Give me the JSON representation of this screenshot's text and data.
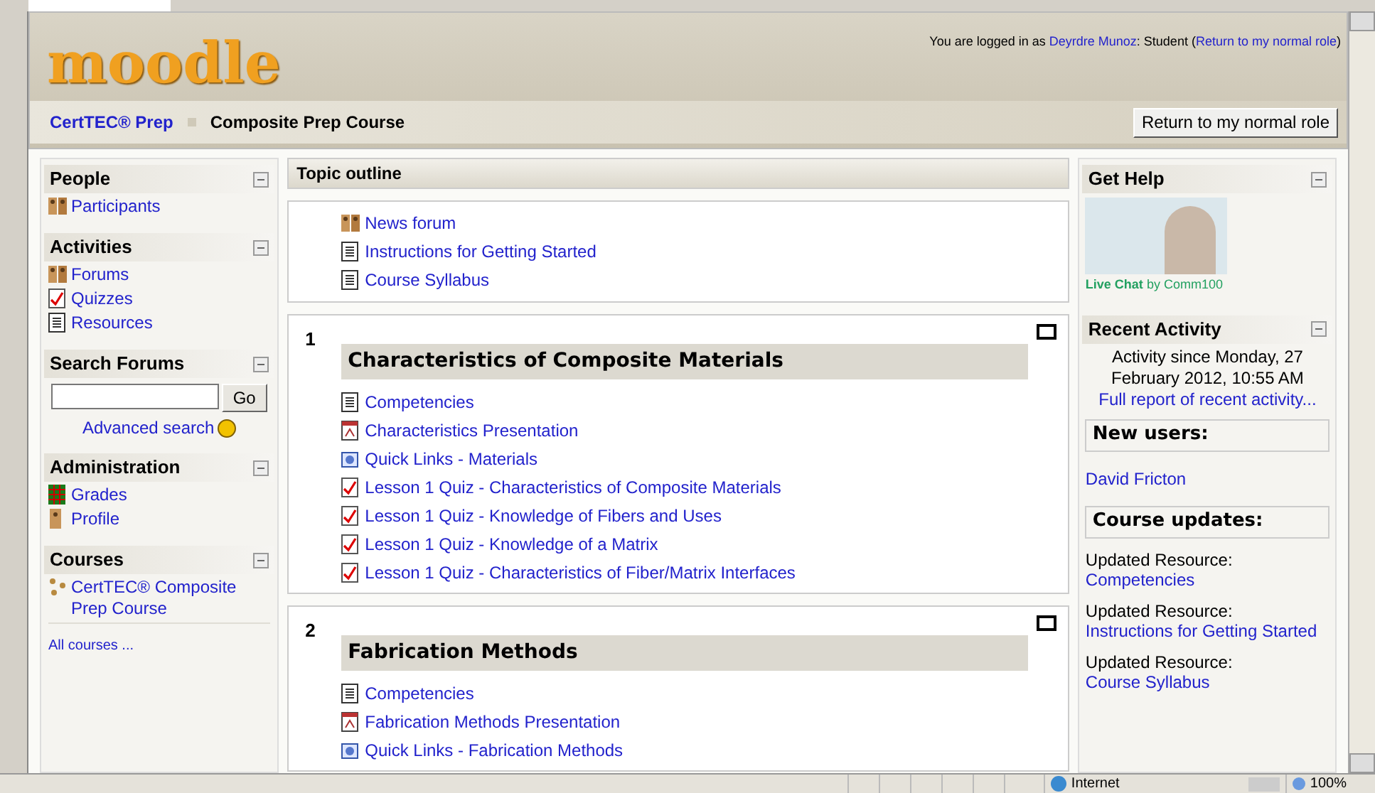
{
  "header": {
    "logo": "moodle",
    "login_prefix": "You are logged in as",
    "user": "Deyrdre Munoz",
    "login_role": ": Student (",
    "return_link": "Return to my normal role",
    "login_suffix": ")"
  },
  "navbar": {
    "breadcrumbs": [
      {
        "label": "CertTEC® Prep",
        "link": true
      },
      {
        "label": "Composite Prep Course",
        "link": false
      }
    ],
    "button": "Return to my normal role"
  },
  "left_blocks": [
    {
      "title": "People",
      "items": [
        {
          "kind": "people",
          "label": "Participants"
        }
      ]
    },
    {
      "title": "Activities",
      "items": [
        {
          "kind": "forum",
          "label": "Forums"
        },
        {
          "kind": "quiz",
          "label": "Quizzes"
        },
        {
          "kind": "resource",
          "label": "Resources"
        }
      ]
    },
    {
      "title": "Search Forums",
      "search": {
        "button": "Go",
        "advanced": "Advanced search"
      }
    },
    {
      "title": "Administration",
      "items": [
        {
          "kind": "grades",
          "label": "Grades"
        },
        {
          "kind": "profile",
          "label": "Profile"
        }
      ]
    },
    {
      "title": "Courses",
      "items": [
        {
          "kind": "course",
          "label": "CertTEC® Composite Prep Course"
        }
      ],
      "footer": "All courses ..."
    }
  ],
  "topic_outline": {
    "title": "Topic outline",
    "intro": [
      {
        "kind": "forum",
        "label": "News forum"
      },
      {
        "kind": "resource",
        "label": "Instructions for Getting Started"
      },
      {
        "kind": "resource",
        "label": "Course Syllabus"
      }
    ],
    "sections": [
      {
        "number": "1",
        "title": "Characteristics of Composite Materials",
        "items": [
          {
            "kind": "resource",
            "label": "Competencies"
          },
          {
            "kind": "pdf",
            "label": "Characteristics Presentation"
          },
          {
            "kind": "link",
            "label": "Quick Links - Materials"
          },
          {
            "kind": "quiz",
            "label": "Lesson 1 Quiz - Characteristics of Composite Materials"
          },
          {
            "kind": "quiz",
            "label": "Lesson 1 Quiz - Knowledge of Fibers and Uses"
          },
          {
            "kind": "quiz",
            "label": "Lesson 1 Quiz - Knowledge of a Matrix"
          },
          {
            "kind": "quiz",
            "label": "Lesson 1 Quiz - Characteristics of Fiber/Matrix Interfaces"
          }
        ]
      },
      {
        "number": "2",
        "title": "Fabrication Methods",
        "items": [
          {
            "kind": "resource",
            "label": "Competencies"
          },
          {
            "kind": "pdf",
            "label": "Fabrication Methods Presentation"
          },
          {
            "kind": "link",
            "label": "Quick Links - Fabrication Methods"
          }
        ]
      }
    ]
  },
  "right": {
    "get_help": {
      "title": "Get Help",
      "live_chat": "Live Chat",
      "by": "by",
      "provider": "Comm100"
    },
    "recent": {
      "title": "Recent Activity",
      "since": "Activity since Monday, 27 February 2012, 10:55 AM",
      "full_report": "Full report of recent activity...",
      "new_users_title": "New users:",
      "new_users": [
        "David Fricton"
      ],
      "updates_title": "Course updates:",
      "updates": [
        {
          "label": "Updated Resource:",
          "link": "Competencies"
        },
        {
          "label": "Updated Resource:",
          "link": "Instructions for Getting Started"
        },
        {
          "label": "Updated Resource:",
          "link": "Course Syllabus"
        }
      ]
    }
  },
  "status_bar": {
    "zone": "Internet",
    "zoom": "100%"
  }
}
